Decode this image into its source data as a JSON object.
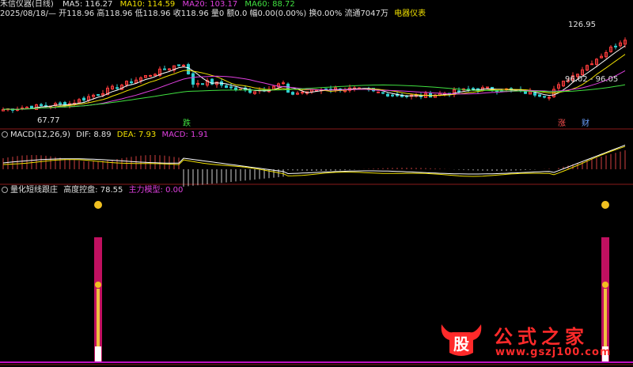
{
  "header": {
    "stock_name": "禾信仪器(日线)",
    "ma5": "MA5: 116.27",
    "ma10": "MA10: 114.59",
    "ma20": "MA20: 103.17",
    "ma60": "MA60: 88.72",
    "quote_line": "2025/08/18/— 开118.96 高118.96 低118.96 收118.96 量0 额0.0 幅0.00(0.00%) 换0.00% 流通7047万",
    "sector": "电器仪表"
  },
  "main_chart": {
    "high_label": "126.95",
    "low_label": "67.77",
    "range_label": "96.02 - 96.05",
    "marker_die": "跌",
    "marker_zhang": "涨",
    "marker_cai": "财"
  },
  "macd_panel": {
    "title": "MACD(12,26,9)",
    "dif": "DIF: 8.89",
    "dea": "DEA: 7.93",
    "macd": "MACD: 1.91"
  },
  "indicator_panel": {
    "title": "量化短线跟庄",
    "gaodu_label": "高度控盘: 78.55",
    "zhuli_label": "主力模型: 0.00"
  },
  "watermark": {
    "logo_char": "股",
    "title": "公式之家",
    "url": "www.gszj100.com"
  },
  "chart_data": {
    "type": "candlestick",
    "ma_lines": [
      {
        "name": "MA5",
        "value": 116.27,
        "color": "#ffffff"
      },
      {
        "name": "MA10",
        "value": 114.59,
        "color": "#f0e000"
      },
      {
        "name": "MA20",
        "value": 103.17,
        "color": "#e040e0"
      },
      {
        "name": "MA60",
        "value": 88.72,
        "color": "#40e040"
      }
    ],
    "price_high": 126.95,
    "price_low": 67.77,
    "last_close": 118.96,
    "macd": {
      "dif": 8.89,
      "dea": 7.93,
      "macd": 1.91
    },
    "indicator": {
      "gaodu_kongpan": 78.55,
      "zhuli_moxing": 0.0
    },
    "colors": {
      "up": "#ff3c3c",
      "down": "#30d0d0",
      "panel_border": "#8a1a1a",
      "macd_up": "#d04040",
      "macd_down": "#d0d0d0"
    }
  }
}
